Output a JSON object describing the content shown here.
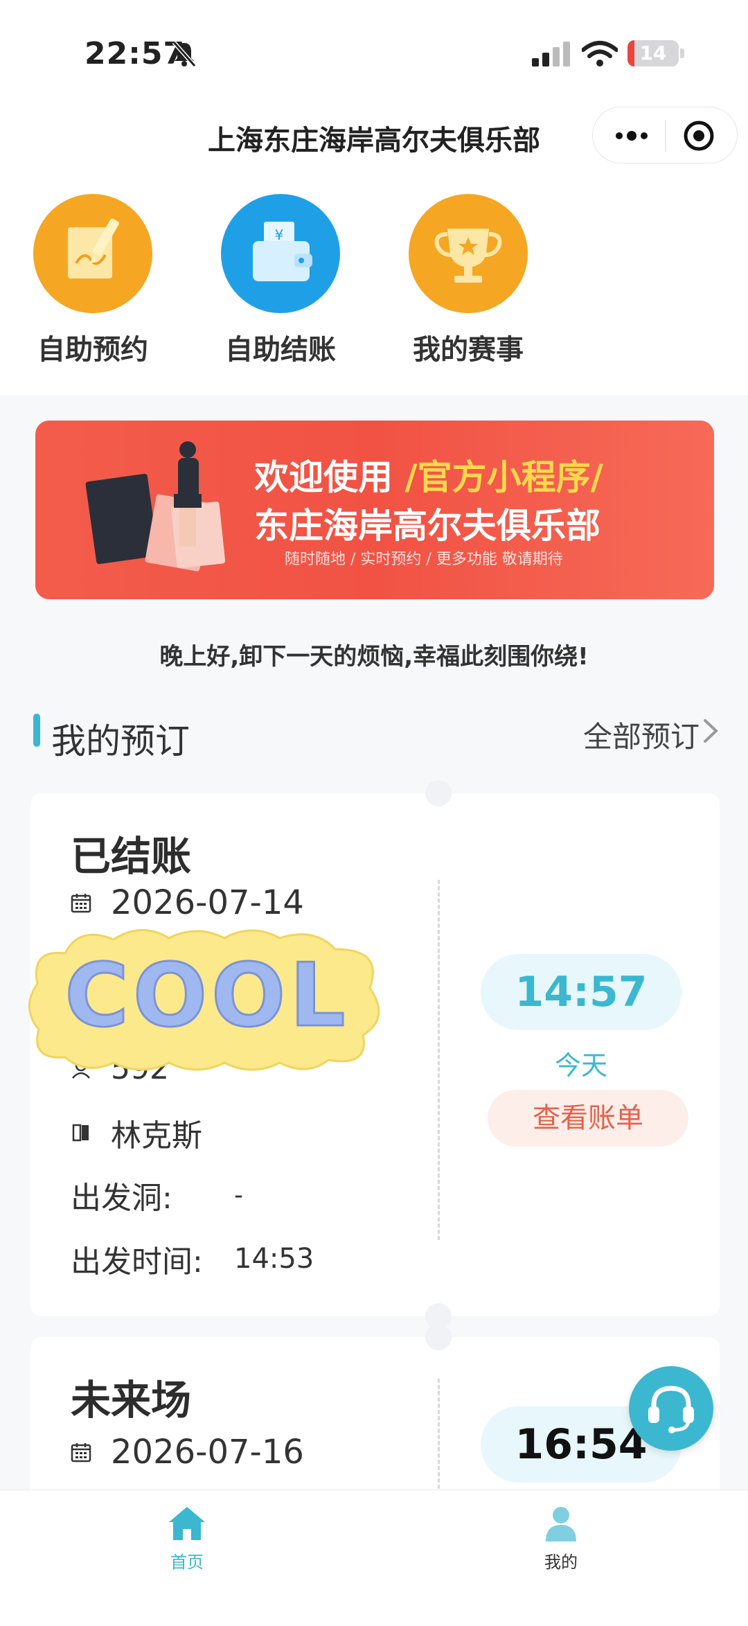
{
  "status_bar": {
    "time": "22:57",
    "battery": "14",
    "battery_level": 0.14
  },
  "nav": {
    "title": "上海东庄海岸高尔夫俱乐部"
  },
  "actions": [
    {
      "label": "自助预约",
      "icon": "edit-pen-icon",
      "color": "#f5a623"
    },
    {
      "label": "自助结账",
      "icon": "wallet-icon",
      "color": "#1fa0e6"
    },
    {
      "label": "我的赛事",
      "icon": "trophy-icon",
      "color": "#f5a623"
    }
  ],
  "banner": {
    "line1_prefix": "欢迎使用",
    "line1_highlight": "/官方小程序/",
    "line2": "东庄海岸高尔夫俱乐部",
    "line3": "随时随地 / 实时预约 / 更多功能 敬请期待"
  },
  "greeting": "晚上好,卸下一天的烦恼,幸福此刻围你绕!",
  "section": {
    "title": "我的预订",
    "link": "全部预订"
  },
  "bookings": [
    {
      "status": "已结账",
      "date": "2026-07-14",
      "member": "592",
      "course": "林克斯",
      "tee_label": "出发洞:",
      "tee_value": "-",
      "tee_time_label": "出发时间:",
      "tee_time_value": "14:53",
      "time": "14:57",
      "day": "今天",
      "action": "查看账单"
    },
    {
      "status": "未来场",
      "date": "2026-07-16",
      "time": "16:54"
    }
  ],
  "sticker": {
    "text": "COOL"
  },
  "tabbar": [
    {
      "label": "首页",
      "icon": "home-icon",
      "active": true
    },
    {
      "label": "我的",
      "icon": "profile-icon",
      "active": false
    }
  ],
  "colors": {
    "accent": "#3bb7d0",
    "orange": "#f5a623",
    "blue": "#1fa0e6",
    "banner": "#f15244"
  }
}
